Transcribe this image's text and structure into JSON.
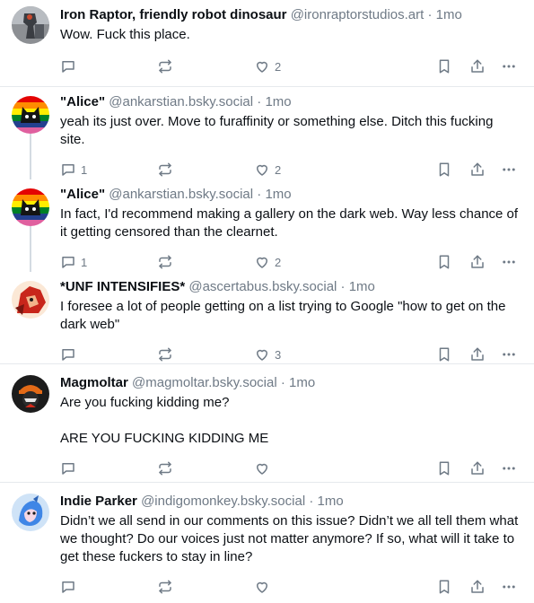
{
  "posts": [
    {
      "author": "Iron Raptor, friendly robot dinosaur",
      "handle": "@ironraptorstudios.art",
      "separator": "·",
      "time": "1mo",
      "text": "Wow. Fuck this place.",
      "replies": "",
      "likes": "2"
    },
    {
      "author": "\"Alice\"",
      "handle": "@ankarstian.bsky.social",
      "separator": "·",
      "time": "1mo",
      "text": "yeah its just over. Move to furaffinity or something else. Ditch this fucking site.",
      "replies": "1",
      "likes": "2"
    },
    {
      "author": "\"Alice\"",
      "handle": "@ankarstian.bsky.social",
      "separator": "·",
      "time": "1mo",
      "text": "In fact, I'd recommend making a gallery on the dark web. Way less chance of it getting censored than the clearnet.",
      "replies": "1",
      "likes": "2"
    },
    {
      "author": "*UNF INTENSIFIES*",
      "handle": "@ascertabus.bsky.social",
      "separator": "·",
      "time": "1mo",
      "text": "I foresee a lot of people getting on a list trying to Google \"how to get on the dark web\"",
      "replies": "",
      "likes": "3"
    },
    {
      "author": "Magmoltar",
      "handle": "@magmoltar.bsky.social",
      "separator": "·",
      "time": "1mo",
      "text": "Are you fucking kidding me?\n\nARE YOU FUCKING KIDDING ME",
      "replies": "",
      "likes": ""
    },
    {
      "author": "Indie Parker",
      "handle": "@indigomonkey.bsky.social",
      "separator": "·",
      "time": "1mo",
      "text": "Didn’t we all send in our comments on this issue? Didn’t we all tell them what we thought? Do our voices just not matter anymore? If so, what will it take to get these fuckers to stay in line?",
      "replies": "",
      "likes": ""
    }
  ],
  "icons": {
    "reply": "reply-icon",
    "repost": "repost-icon",
    "like": "heart-icon",
    "bookmark": "bookmark-icon",
    "share": "share-icon",
    "more": "more-options-icon"
  },
  "colors": {
    "text": "#0b0f14",
    "muted": "#6f7a86",
    "divider": "#e6e9ed",
    "thread_line": "#d4dbe2"
  }
}
